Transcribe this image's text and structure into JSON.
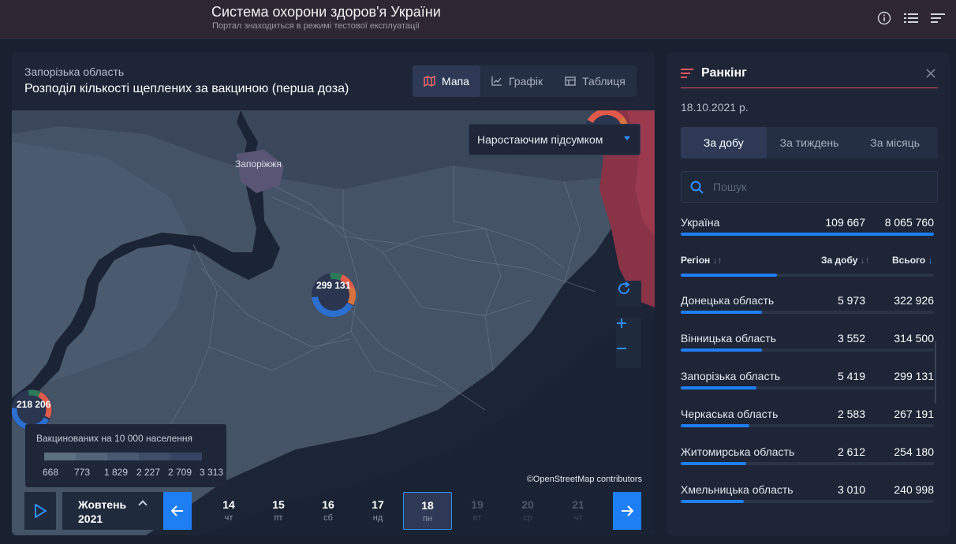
{
  "header": {
    "title": "Система охорони здоров'я України",
    "subtitle": "Портал знаходиться в режимі тестової експлуатації",
    "icons": [
      "info-icon",
      "list-icon",
      "menu-icon"
    ]
  },
  "main": {
    "region": "Запорізька область",
    "title": "Розподіл кількості щеплених за вакциною (перша доза)",
    "tabs": [
      {
        "label": "Мапа",
        "icon": "map-icon",
        "active": true
      },
      {
        "label": "Графік",
        "icon": "chart-icon",
        "active": false
      },
      {
        "label": "Таблиця",
        "icon": "table-icon",
        "active": false
      }
    ],
    "mode_select": "Наростаючим підсумком",
    "city_label": "Запоріжжя",
    "clusters": [
      "299 131",
      "218 206"
    ],
    "legend": {
      "title": "Вакцинованих на 10 000 населення",
      "colors": [
        "#5c6f80",
        "#52647a",
        "#485972",
        "#3f4e69",
        "#364461"
      ],
      "labels": [
        "668",
        "773",
        "1 829",
        "2 227",
        "2 709",
        "3 313"
      ]
    },
    "attribution": "©OpenStreetMap contributors",
    "timeline": {
      "month": "Жовтень",
      "year": "2021",
      "days": [
        {
          "n": "14",
          "w": "чт",
          "state": "normal"
        },
        {
          "n": "15",
          "w": "пт",
          "state": "normal"
        },
        {
          "n": "16",
          "w": "сб",
          "state": "normal"
        },
        {
          "n": "17",
          "w": "нд",
          "state": "normal"
        },
        {
          "n": "18",
          "w": "пн",
          "state": "active"
        },
        {
          "n": "19",
          "w": "вт",
          "state": "disabled"
        },
        {
          "n": "20",
          "w": "ср",
          "state": "disabled"
        },
        {
          "n": "21",
          "w": "чт",
          "state": "disabled"
        }
      ]
    }
  },
  "ranking": {
    "title": "Ранкінг",
    "date": "18.10.2021 р.",
    "periods": [
      "За добу",
      "За тиждень",
      "За місяць"
    ],
    "active_period": 0,
    "search_placeholder": "Пошук",
    "total": {
      "name": "Україна",
      "daily": "109 667",
      "total": "8 065 760",
      "share": 1.0
    },
    "columns": {
      "region": "Регіон",
      "daily": "За добу",
      "total": "Всього"
    },
    "rows": [
      {
        "name": "Донецька область",
        "daily": "5 973",
        "total": "322 926",
        "share": 0.32
      },
      {
        "name": "Вінницька область",
        "daily": "3 552",
        "total": "314 500",
        "share": 0.32
      },
      {
        "name": "Запорізька область",
        "daily": "5 419",
        "total": "299 131",
        "share": 0.3
      },
      {
        "name": "Черкаська область",
        "daily": "2 583",
        "total": "267 191",
        "share": 0.27
      },
      {
        "name": "Житомирська область",
        "daily": "2 612",
        "total": "254 180",
        "share": 0.26
      },
      {
        "name": "Хмельницька область",
        "daily": "3 010",
        "total": "240 998",
        "share": 0.25
      }
    ],
    "header_bar_share": 0.38
  }
}
